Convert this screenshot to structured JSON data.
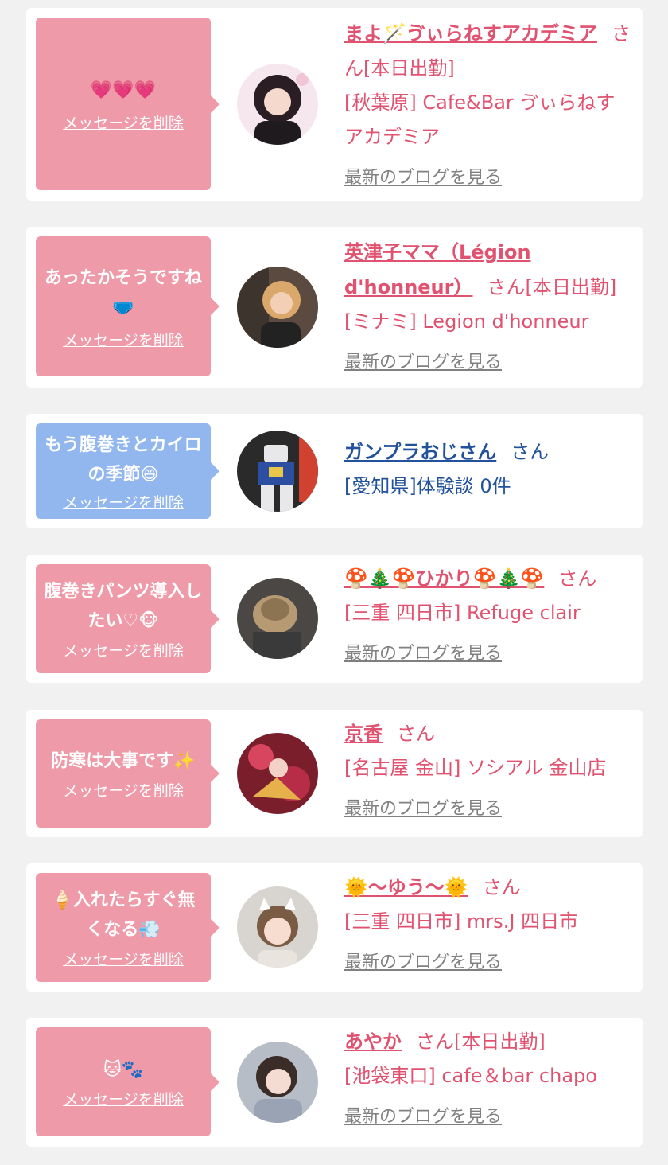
{
  "common": {
    "delete_label": "メッセージを削除",
    "blog_label": "最新のブログを見る"
  },
  "colors": {
    "bubble_pink": "#ef9aa8",
    "bubble_blue": "#92b6ee",
    "name_pink": "#e0526f",
    "name_blue": "#23529c",
    "blog_gray": "#808080"
  },
  "items": [
    {
      "message": "💗💗💗",
      "name": "まよ🪄ゔぃらねすアカデミア",
      "suffix": "さん[本日出勤]",
      "shop": "[秋葉原] Cafe&Bar ゔぃらねすアカデミア",
      "blog": "最新のブログを見る",
      "bubble_color": "pink"
    },
    {
      "message": "あったかそうですね🩲",
      "name": "英津子ママ（Légion d'honneur）",
      "suffix": "さん[本日出勤]",
      "shop": "[ミナミ] Legion d'honneur",
      "blog": "最新のブログを見る",
      "bubble_color": "pink"
    },
    {
      "message": "もう腹巻きとカイロの季節😄",
      "name": "ガンプラおじさん",
      "suffix": "さん",
      "shop": "[愛知県]体験談 0件",
      "blog": "",
      "bubble_color": "blue"
    },
    {
      "message": "腹巻きパンツ導入したい♡🐵",
      "name": "🍄🎄🍄ひかり🍄🎄🍄",
      "suffix": "さん",
      "shop": "[三重 四日市] Refuge clair",
      "blog": "最新のブログを見る",
      "bubble_color": "pink"
    },
    {
      "message": "防寒は大事です✨",
      "name": "京香",
      "suffix": "さん",
      "shop": "[名古屋 金山] ソシアル 金山店",
      "blog": "最新のブログを見る",
      "bubble_color": "pink"
    },
    {
      "message": "🍦入れたらすぐ無くなる💨",
      "name": "🌞〜ゆう〜🌞",
      "suffix": "さん",
      "shop": "[三重 四日市] mrs.J 四日市",
      "blog": "最新のブログを見る",
      "bubble_color": "pink"
    },
    {
      "message": "🐱🐾",
      "name": "あやか",
      "suffix": "さん[本日出勤]",
      "shop": "[池袋東口] cafe＆bar chapo",
      "blog": "最新のブログを見る",
      "bubble_color": "pink"
    }
  ]
}
